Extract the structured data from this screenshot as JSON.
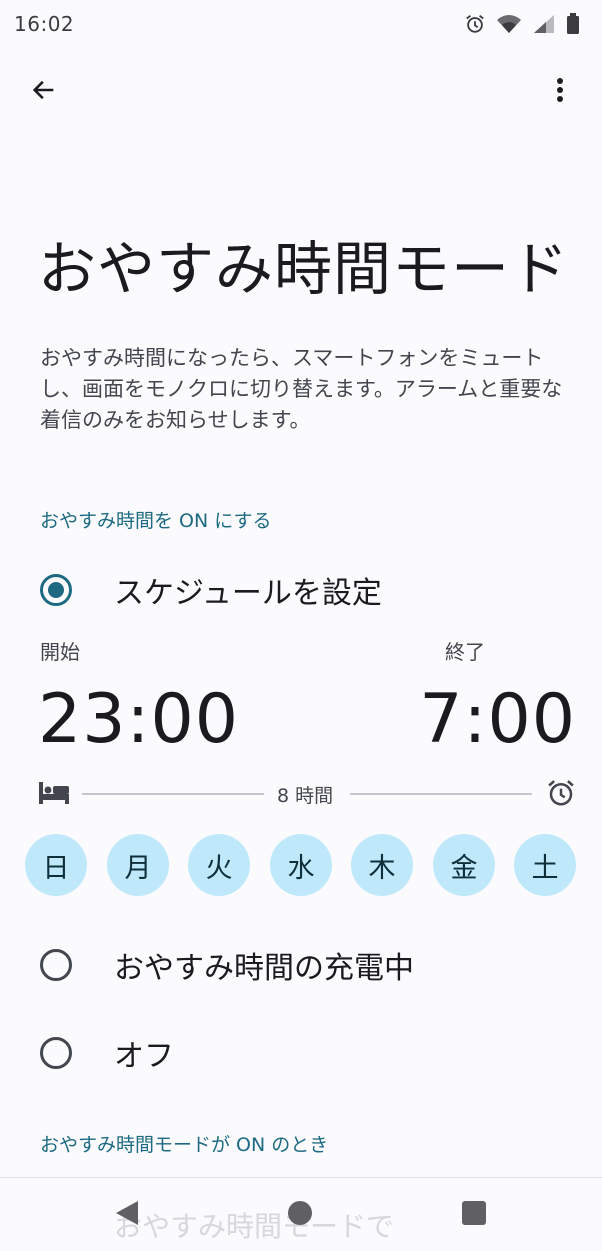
{
  "status_bar": {
    "time": "16:02",
    "icons": [
      "alarm-icon",
      "wifi-icon",
      "signal-icon",
      "battery-icon"
    ]
  },
  "app_bar": {
    "back_icon": "arrow-back-icon",
    "more_icon": "more-vert-icon"
  },
  "page": {
    "title": "おやすみ時間モード",
    "description": "おやすみ時間になったら、スマートフォンをミュートし、画面をモノクロに切り替えます。アラームと重要な着信のみをお知らせします。"
  },
  "section_turn_on": {
    "header": "おやすみ時間を ON にする",
    "options": [
      {
        "label": "スケジュールを設定",
        "checked": true
      },
      {
        "label": "おやすみ時間の充電中",
        "checked": false
      },
      {
        "label": "オフ",
        "checked": false
      }
    ]
  },
  "schedule": {
    "start_label": "開始",
    "start_time": "23:00",
    "end_label": "終了",
    "end_time": "7:00",
    "duration": "8 時間",
    "days": [
      "日",
      "月",
      "火",
      "水",
      "木",
      "金",
      "土"
    ],
    "accent_color": "#1d6a82",
    "chip_color": "#bfe9fb"
  },
  "section_when_on": {
    "header": "おやすみ時間モードが ON のとき",
    "partial_item": "おやすみ時間モードで"
  }
}
